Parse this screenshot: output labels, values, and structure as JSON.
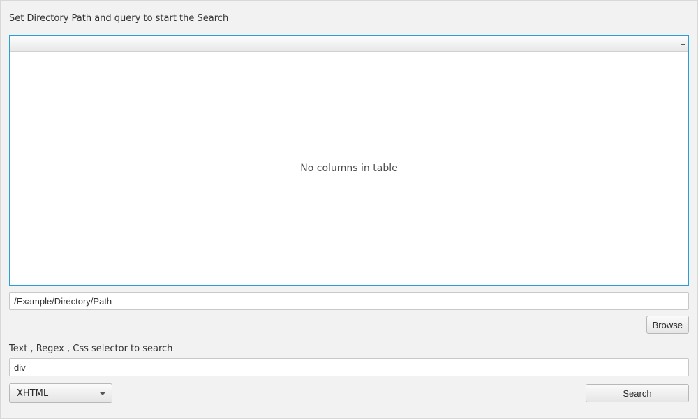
{
  "title": "Set Directory Path and query to start the Search",
  "table": {
    "empty_message": "No columns in table",
    "add_column_glyph": "+"
  },
  "path_input": {
    "value": "/Example/Directory/Path",
    "placeholder": ""
  },
  "browse_button": "Browse",
  "query_label": "Text , Regex , Css selector to search",
  "query_input": {
    "value": "div",
    "placeholder": ""
  },
  "mode_select": {
    "selected": "XHTML"
  },
  "search_button": "Search"
}
